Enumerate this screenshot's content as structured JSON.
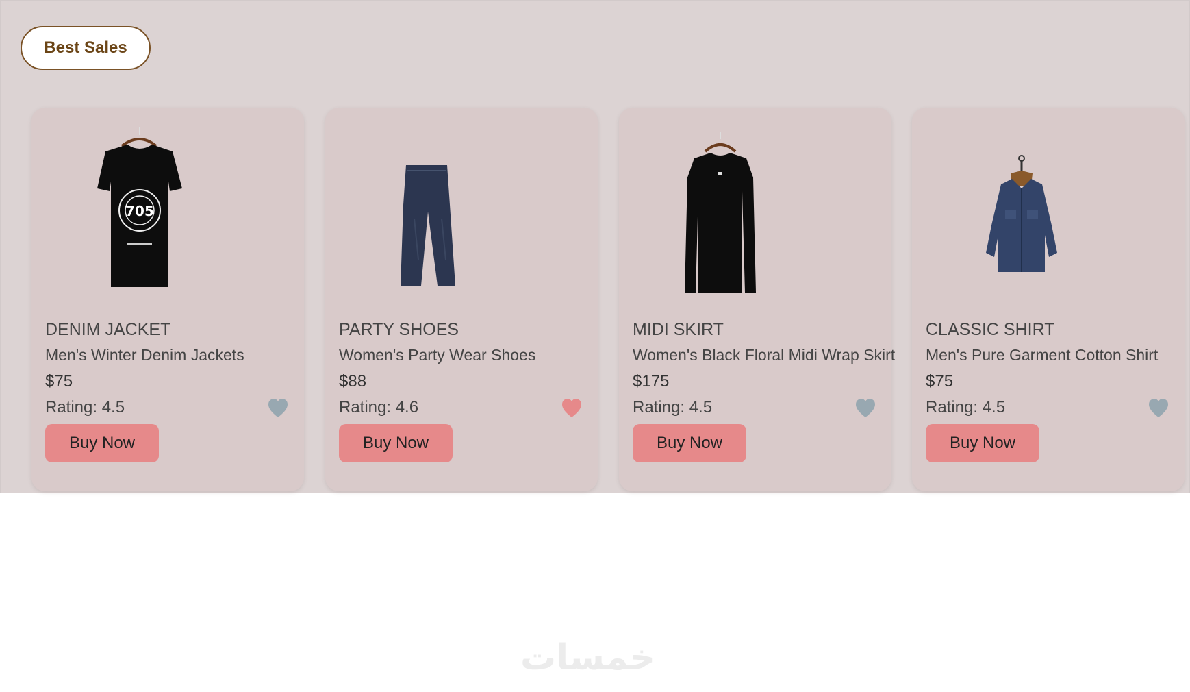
{
  "section": {
    "label": "Best Sales"
  },
  "colors": {
    "panel_bg": "#dcd3d3",
    "card_bg": "#d9caca",
    "accent_button": "#e6898a",
    "heart_inactive": "#98a8b1",
    "heart_active": "#e6898a",
    "pill_border": "#7a5226"
  },
  "products": [
    {
      "category": "DENIM JACKET",
      "name": "Men's Winter Denim Jackets",
      "price": "$75",
      "rating_label": "Rating: 4.5",
      "button": "Buy Now",
      "favorited": false,
      "image_icon": "black-tshirt-on-hanger-icon"
    },
    {
      "category": "PARTY SHOES",
      "name": "Women's Party Wear Shoes",
      "price": "$88",
      "rating_label": "Rating: 4.6",
      "button": "Buy Now",
      "favorited": true,
      "image_icon": "denim-jeans-icon"
    },
    {
      "category": "MIDI SKIRT",
      "name": "Women's Black Floral Midi Wrap Skirt",
      "price": "$175",
      "rating_label": "Rating: 4.5",
      "button": "Buy Now",
      "favorited": false,
      "image_icon": "black-longsleeve-on-hanger-icon"
    },
    {
      "category": "CLASSIC SHIRT",
      "name": "Men's Pure Garment Cotton Shirt",
      "price": "$75",
      "rating_label": "Rating: 4.5",
      "button": "Buy Now",
      "favorited": false,
      "image_icon": "denim-jacket-on-hanger-icon"
    }
  ],
  "watermark": {
    "text": "خمسات"
  }
}
